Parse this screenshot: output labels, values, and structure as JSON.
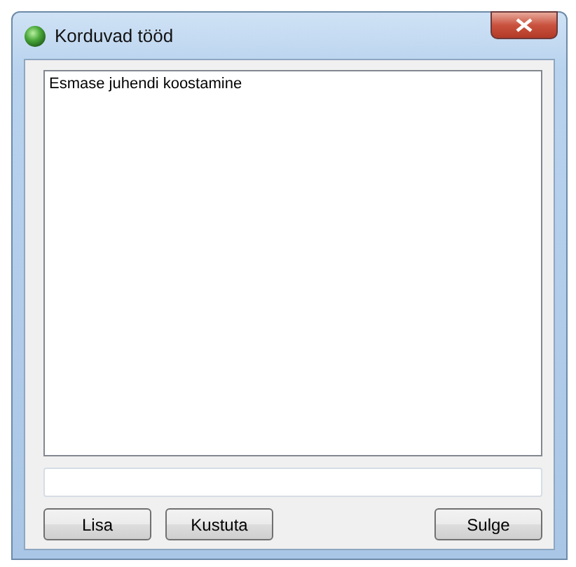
{
  "window": {
    "title": "Korduvad tööd"
  },
  "list": {
    "items": [
      {
        "label": "Esmase juhendi koostamine",
        "selected": false
      }
    ]
  },
  "buttons": [
    "Lisa",
    "Kustuta",
    "Sulge"
  ]
}
